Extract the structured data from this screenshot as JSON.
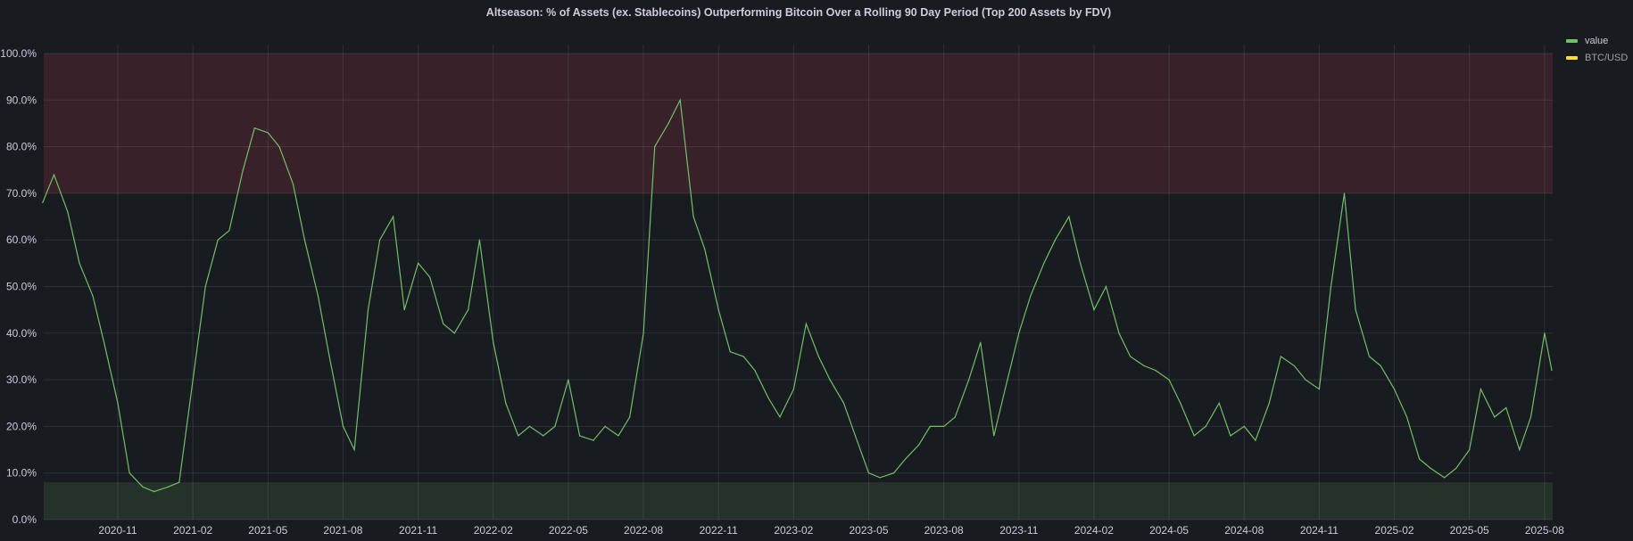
{
  "chart_data": {
    "type": "line",
    "title": "Altseason: % of Assets (ex. Stablecoins) Outperforming Bitcoin Over a Rolling 90 Day Period (Top 200 Assets by FDV)",
    "xlabel": "",
    "ylabel": "",
    "ylim": [
      0,
      100
    ],
    "y_ticks": [
      "0.0%",
      "10.0%",
      "20.0%",
      "30.0%",
      "40.0%",
      "50.0%",
      "60.0%",
      "70.0%",
      "80.0%",
      "90.0%",
      "100.0%"
    ],
    "x_ticks": [
      "2020-11",
      "2021-02",
      "2021-05",
      "2021-08",
      "2021-11",
      "2022-02",
      "2022-05",
      "2022-08",
      "2022-11",
      "2023-02",
      "2023-05",
      "2023-08",
      "2023-11",
      "2024-02",
      "2024-05",
      "2024-08",
      "2024-11",
      "2025-02",
      "2025-05",
      "2025-08"
    ],
    "grid": true,
    "legend_placement": "right",
    "bands": [
      {
        "from": 70,
        "to": 100,
        "color": "#f2495c"
      },
      {
        "from": 0,
        "to": 8,
        "color": "#73bf69"
      }
    ],
    "series": [
      {
        "name": "value",
        "color": "#73bf69",
        "x": [
          "2020-08-01",
          "2020-08-15",
          "2020-09-01",
          "2020-09-15",
          "2020-10-01",
          "2020-10-15",
          "2020-11-01",
          "2020-11-15",
          "2020-12-01",
          "2020-12-15",
          "2021-01-01",
          "2021-01-15",
          "2021-02-01",
          "2021-02-15",
          "2021-03-01",
          "2021-03-15",
          "2021-04-01",
          "2021-04-15",
          "2021-05-01",
          "2021-05-15",
          "2021-06-01",
          "2021-06-15",
          "2021-07-01",
          "2021-07-15",
          "2021-08-01",
          "2021-08-15",
          "2021-09-01",
          "2021-09-15",
          "2021-10-01",
          "2021-10-15",
          "2021-11-01",
          "2021-11-15",
          "2021-12-01",
          "2021-12-15",
          "2022-01-01",
          "2022-01-15",
          "2022-02-01",
          "2022-02-15",
          "2022-03-01",
          "2022-03-15",
          "2022-04-01",
          "2022-04-15",
          "2022-05-01",
          "2022-05-15",
          "2022-06-01",
          "2022-06-15",
          "2022-07-01",
          "2022-07-15",
          "2022-08-01",
          "2022-08-15",
          "2022-09-01",
          "2022-09-15",
          "2022-10-01",
          "2022-10-15",
          "2022-11-01",
          "2022-11-15",
          "2022-12-01",
          "2022-12-15",
          "2023-01-01",
          "2023-01-15",
          "2023-02-01",
          "2023-02-15",
          "2023-03-01",
          "2023-03-15",
          "2023-04-01",
          "2023-04-15",
          "2023-05-01",
          "2023-05-15",
          "2023-06-01",
          "2023-06-15",
          "2023-07-01",
          "2023-07-15",
          "2023-08-01",
          "2023-08-15",
          "2023-09-01",
          "2023-09-15",
          "2023-10-01",
          "2023-10-15",
          "2023-11-01",
          "2023-11-15",
          "2023-12-01",
          "2023-12-15",
          "2024-01-01",
          "2024-01-15",
          "2024-02-01",
          "2024-02-15",
          "2024-03-01",
          "2024-03-15",
          "2024-04-01",
          "2024-04-15",
          "2024-05-01",
          "2024-05-15",
          "2024-06-01",
          "2024-06-15",
          "2024-07-01",
          "2024-07-15",
          "2024-08-01",
          "2024-08-15",
          "2024-09-01",
          "2024-09-15",
          "2024-10-01",
          "2024-10-15",
          "2024-11-01",
          "2024-11-15",
          "2024-12-01",
          "2024-12-15",
          "2025-01-01",
          "2025-01-15",
          "2025-02-01",
          "2025-02-15",
          "2025-03-01",
          "2025-03-15",
          "2025-04-01",
          "2025-04-15",
          "2025-05-01",
          "2025-05-15",
          "2025-06-01",
          "2025-06-15",
          "2025-07-01",
          "2025-07-15",
          "2025-08-01",
          "2025-08-10"
        ],
        "values": [
          68,
          74,
          66,
          55,
          48,
          38,
          25,
          10,
          7,
          6,
          7,
          8,
          30,
          50,
          60,
          62,
          75,
          84,
          83,
          80,
          72,
          60,
          48,
          35,
          20,
          15,
          45,
          60,
          65,
          45,
          55,
          52,
          42,
          40,
          45,
          60,
          38,
          25,
          18,
          20,
          18,
          20,
          30,
          18,
          17,
          20,
          18,
          22,
          40,
          80,
          85,
          90,
          65,
          58,
          45,
          36,
          35,
          32,
          26,
          22,
          28,
          42,
          35,
          30,
          25,
          18,
          10,
          9,
          10,
          13,
          16,
          20,
          20,
          22,
          30,
          38,
          18,
          28,
          40,
          48,
          55,
          60,
          65,
          55,
          45,
          50,
          40,
          35,
          33,
          32,
          30,
          25,
          18,
          20,
          25,
          18,
          20,
          17,
          25,
          35,
          33,
          30,
          28,
          50,
          70,
          45,
          35,
          33,
          28,
          22,
          13,
          11,
          9,
          11,
          15,
          28,
          22,
          24,
          15,
          22,
          40,
          32
        ]
      },
      {
        "name": "BTC/USD",
        "color": "#fade2a",
        "x": [],
        "values": []
      }
    ]
  }
}
